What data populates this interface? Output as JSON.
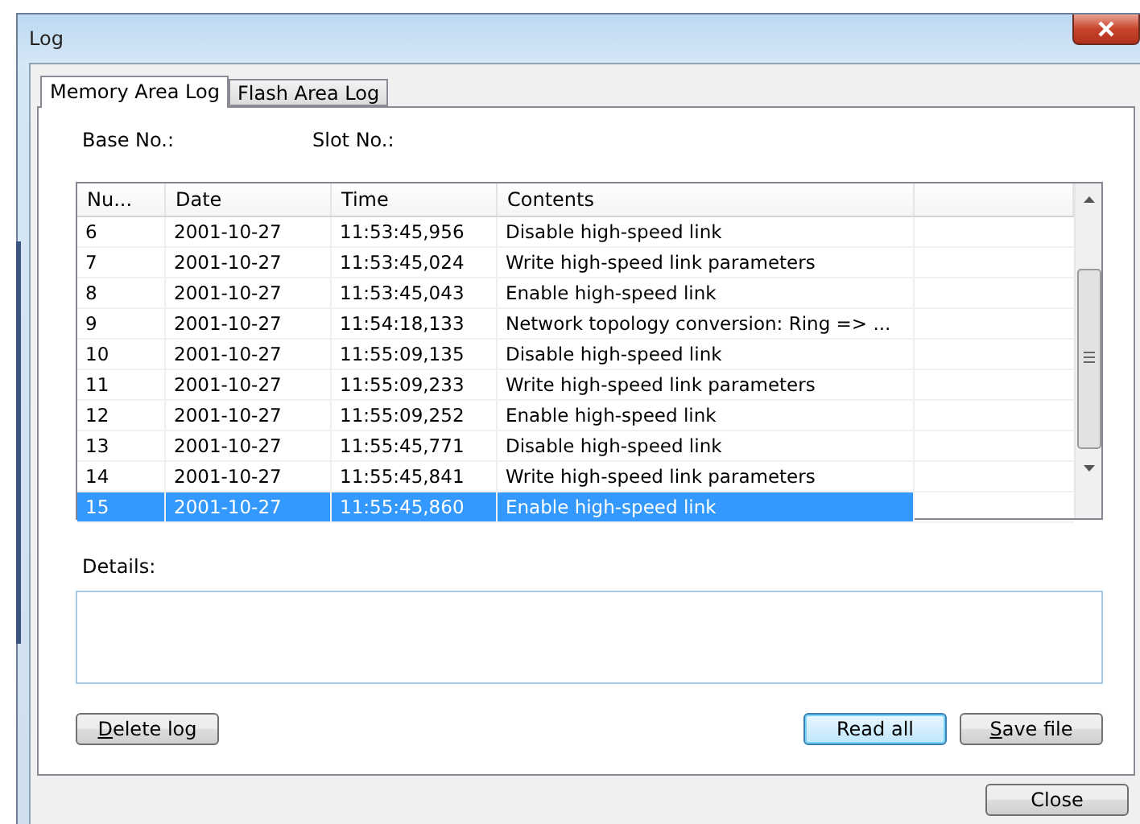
{
  "window": {
    "title": "Log"
  },
  "tabs": [
    {
      "label": "Memory Area Log",
      "selected": true
    },
    {
      "label": "Flash Area Log",
      "selected": false
    }
  ],
  "fields": [
    {
      "label": "Base No.:"
    },
    {
      "label": "Slot No.:"
    }
  ],
  "table": {
    "columns": [
      "Nu...",
      "Date",
      "Time",
      "Contents"
    ],
    "rows": [
      {
        "cells": [
          "6",
          "2001-10-27",
          "11:53:45,956",
          "Disable high-speed link"
        ],
        "selected": false
      },
      {
        "cells": [
          "7",
          "2001-10-27",
          "11:53:45,024",
          "Write high-speed link parameters"
        ],
        "selected": false
      },
      {
        "cells": [
          "8",
          "2001-10-27",
          "11:53:45,043",
          "Enable high-speed link"
        ],
        "selected": false
      },
      {
        "cells": [
          "9",
          "2001-10-27",
          "11:54:18,133",
          "Network topology conversion:  Ring => ..."
        ],
        "selected": false
      },
      {
        "cells": [
          "10",
          "2001-10-27",
          "11:55:09,135",
          "Disable high-speed link"
        ],
        "selected": false
      },
      {
        "cells": [
          "11",
          "2001-10-27",
          "11:55:09,233",
          "Write high-speed link parameters"
        ],
        "selected": false
      },
      {
        "cells": [
          "12",
          "2001-10-27",
          "11:55:09,252",
          "Enable high-speed link"
        ],
        "selected": false
      },
      {
        "cells": [
          "13",
          "2001-10-27",
          "11:55:45,771",
          "Disable high-speed link"
        ],
        "selected": false
      },
      {
        "cells": [
          "14",
          "2001-10-27",
          "11:55:45,841",
          "Write high-speed link parameters"
        ],
        "selected": false
      },
      {
        "cells": [
          "15",
          "2001-10-27",
          "11:55:45,860",
          "Enable high-speed link"
        ],
        "selected": true
      }
    ]
  },
  "details": {
    "label": "Details:"
  },
  "buttons_left": [
    {
      "label": "Delete log",
      "mnemonic": true,
      "focused": false
    }
  ],
  "buttons_right": [
    {
      "label": "Read all",
      "mnemonic": false,
      "focused": true
    },
    {
      "label": "Save file",
      "mnemonic": true,
      "focused": false
    }
  ],
  "footer_buttons": [
    {
      "label": "Close",
      "mnemonic": false,
      "focused": false
    }
  ]
}
